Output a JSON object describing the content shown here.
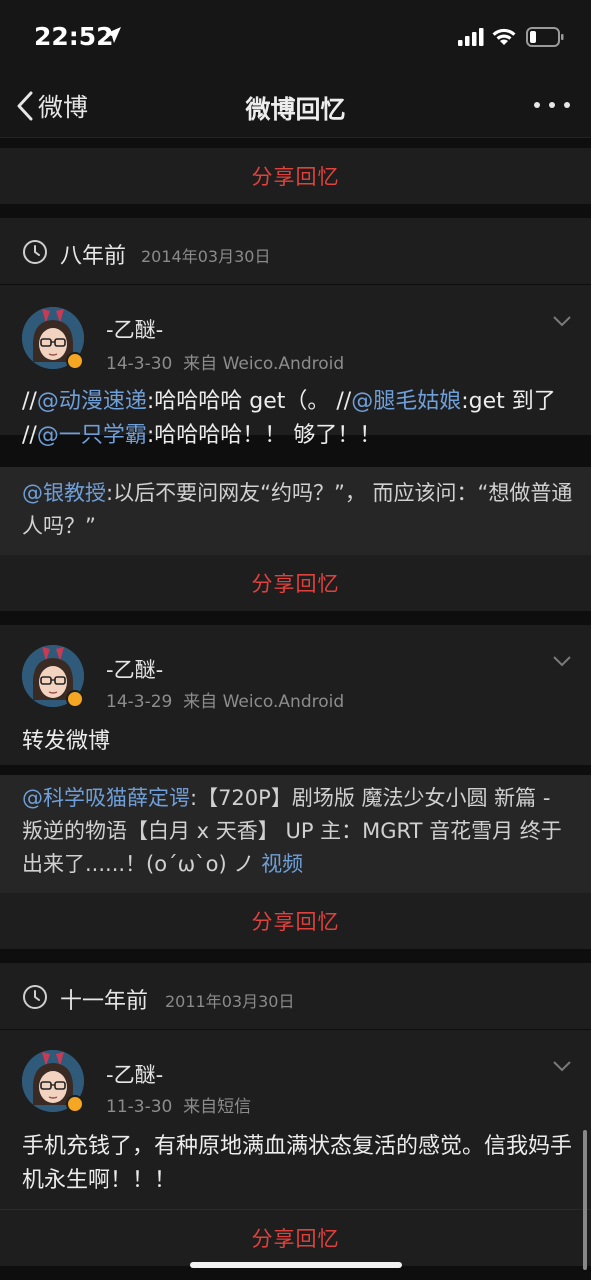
{
  "status_bar": {
    "time": "22:52"
  },
  "nav": {
    "back_label": "微博",
    "title": "微博回忆"
  },
  "share_label": "分享回忆",
  "sections": [
    {
      "year_label": "八年前",
      "date": "2014年03月30日"
    },
    {
      "year_label": "十一年前",
      "date": "2011年03月30日"
    }
  ],
  "posts": [
    {
      "username": "-乙醚-",
      "date": "14-3-30",
      "source": "来自 Weico.Android",
      "text_parts": [
        "//",
        "@动漫速递",
        ":哈哈哈哈 get（。 //",
        "@腿毛姑娘",
        ":get 到了 //",
        "@一只学霸",
        ":哈哈哈哈！！ 够了！！"
      ],
      "repost_parts": [
        "@银教授",
        ":以后不要问网友“约吗？”， 而应该问：“想做普通人吗？”"
      ]
    },
    {
      "username": "-乙醚-",
      "date": "14-3-29",
      "source": "来自 Weico.Android",
      "text": "转发微博",
      "repost_parts": [
        "@科学吸猫薛定谔",
        ":【720P】剧场版 魔法少女小圆 新篇 - 叛逆的物语【白月 x 天香】  UP 主：MGRT 音花雪月  终于出来了......！(o´ω`o) ノ  ",
        "视频"
      ]
    },
    {
      "username": "-乙醚-",
      "date": "11-3-30",
      "source": "来自短信",
      "text": "手机充钱了，有种原地满血满状态复活的感觉。信我妈手机永生啊！！！"
    }
  ],
  "colors": {
    "accent": "#e0413c",
    "link": "#6f9fd8",
    "background": "#0e0e0e",
    "card": "#1e1e1e"
  }
}
